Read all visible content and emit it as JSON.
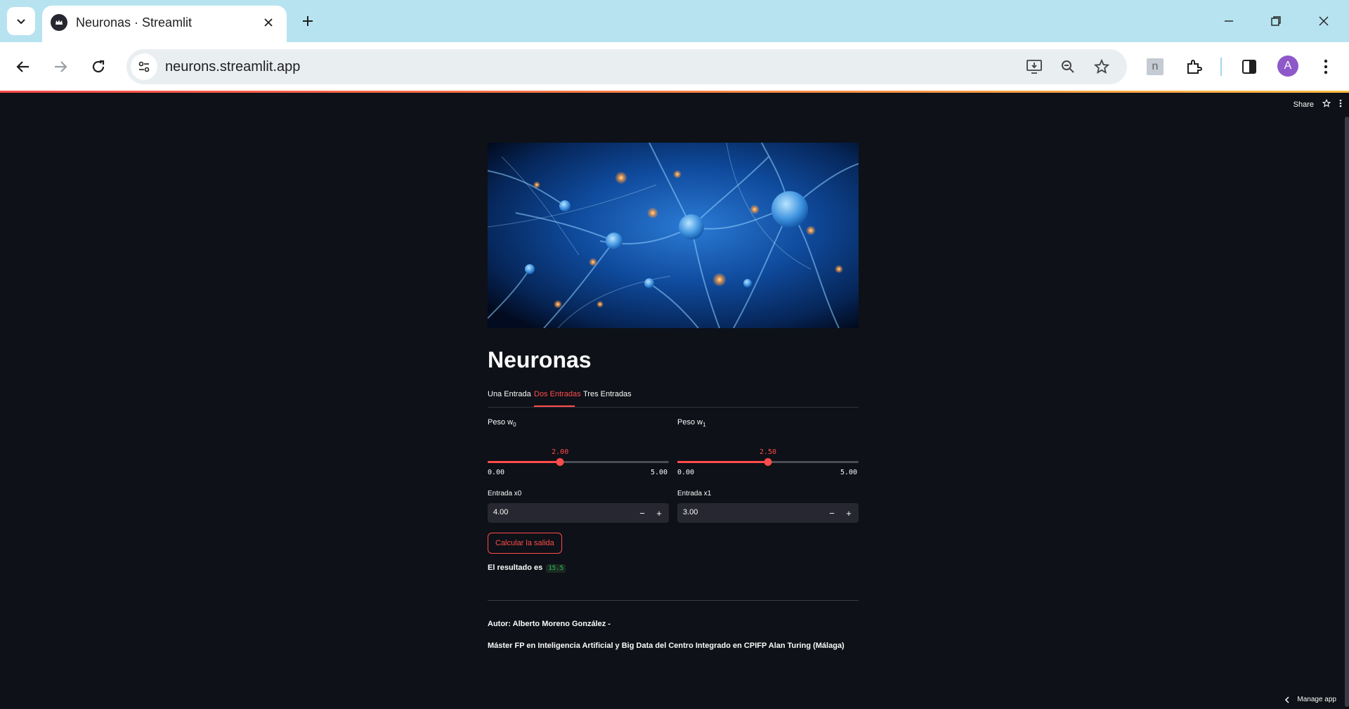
{
  "browser": {
    "tab_title": "Neuronas · Streamlit",
    "url": "neurons.streamlit.app",
    "profile_initial": "A",
    "extension_label": "n"
  },
  "app": {
    "share_label": "Share",
    "manage_app_label": "Manage app",
    "title": "Neuronas",
    "tabs": [
      {
        "label": "Una Entrada",
        "active": false
      },
      {
        "label": "Dos Entradas",
        "active": true
      },
      {
        "label": "Tres Entradas",
        "active": false
      }
    ],
    "weights": [
      {
        "label": "Peso w",
        "subscript": "0",
        "value": "2.00",
        "fraction": 0.4,
        "min": "0.00",
        "max": "5.00"
      },
      {
        "label": "Peso w",
        "subscript": "1",
        "value": "2.50",
        "fraction": 0.5,
        "min": "0.00",
        "max": "5.00"
      }
    ],
    "inputs": [
      {
        "label": "Entrada x0",
        "value": "4.00"
      },
      {
        "label": "Entrada x1",
        "value": "3.00"
      }
    ],
    "calc_button": "Calcular la salida",
    "result_label": "El resultado es",
    "result_value": "15.5",
    "footer": {
      "author": "Autor: Alberto Moreno González -",
      "program": "Máster FP en Inteligencia Artificial y Big Data del Centro Integrado en CPIFP Alan Turing (Málaga)"
    },
    "colors": {
      "accent": "#ff4b4b",
      "background": "#0e1117",
      "result_green": "#21c354"
    }
  }
}
